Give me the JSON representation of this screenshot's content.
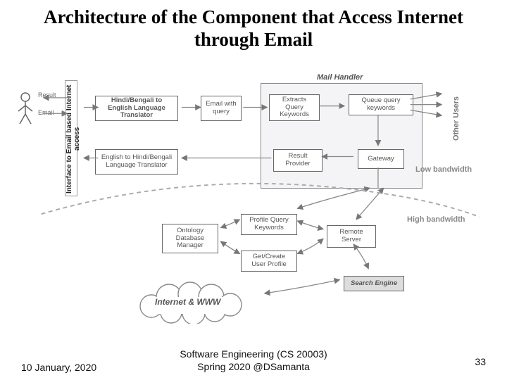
{
  "title": "Architecture of the Component that Access Internet through Email",
  "interface_box_label": "Interface to Email based Internet access",
  "actor_arrows": {
    "top": "Result",
    "bottom": "Email"
  },
  "top_row": {
    "translator_in": "Hindi/Bengali to English Language Translator",
    "email_query": "Email with query",
    "extracts": "Extracts Query Keywords",
    "queue": "Queue query keywords"
  },
  "mid_row": {
    "translator_out": "English to Hindi/Bengali Language Translator",
    "result_provider": "Result Provider",
    "gateway": "Gateway"
  },
  "bottom_group": {
    "ontology": "Ontology Database Manager",
    "profile": "Profile Query Keywords",
    "get_profile": "Get/Create User Profile",
    "remote_server": "Remote Server",
    "search_engine": "Search Engine"
  },
  "mail_handler_label": "Mail Handler",
  "side_labels": {
    "other_users": "Other Users",
    "low_bw": "Low bandwidth",
    "high_bw": "High bandwidth"
  },
  "cloud_label": "Internet & WWW",
  "footer": {
    "date": "10 January, 2020",
    "mid1": "Software Engineering (CS 20003)",
    "mid2": "Spring 2020 @DSamanta",
    "page": "33"
  }
}
